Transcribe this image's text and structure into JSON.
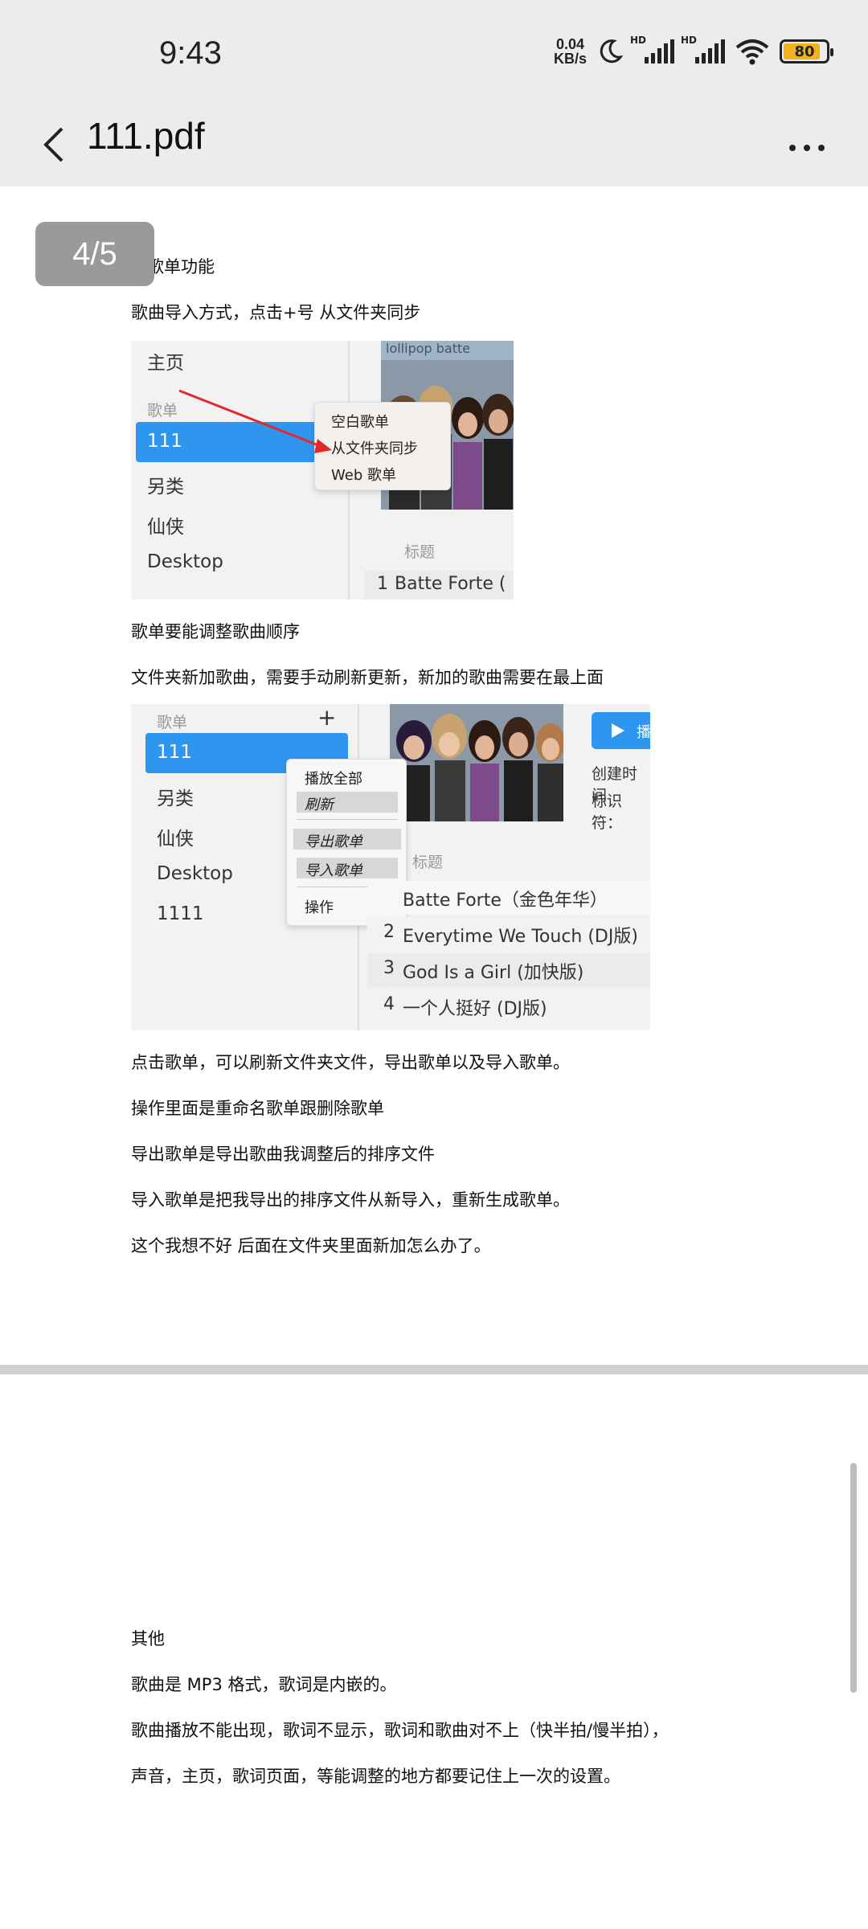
{
  "status_bar": {
    "time": "9:43",
    "net_speed_value": "0.04",
    "net_speed_unit": "KB/s",
    "sim1_label": "HD",
    "sim2_label": "HD",
    "battery": "80"
  },
  "app_bar": {
    "title": "111.pdf"
  },
  "page_indicator": "4/5",
  "page4": {
    "heading": "3.歌单功能",
    "line1": "歌曲导入方式，点击+号  从文件夹同步",
    "screenshot1": {
      "sidebar_home": "主页",
      "sidebar_section": "歌单",
      "selected_playlist": "111",
      "playlists": [
        "另类",
        "仙侠",
        "Desktop"
      ],
      "menu_items": [
        "空白歌单",
        "从文件夹同步",
        "Web 歌单"
      ],
      "photo_caption": "lollipop  batte",
      "column_title": "标题",
      "row_num": "1",
      "row_title": "Batte Forte ("
    },
    "line2": "歌单要能调整歌曲顺序",
    "line3": "文件夹新加歌曲，需要手动刷新更新，新加的歌曲需要在最上面",
    "screenshot2": {
      "sidebar_section": "歌单",
      "add_symbol": "+",
      "selected_playlist": "111",
      "playlists": [
        "另类",
        "仙侠",
        "Desktop",
        "1111"
      ],
      "menu_items": [
        "播放全部",
        "刷新",
        "导出歌单",
        "导入歌单",
        "操作"
      ],
      "menu_arrow": ">",
      "play_button": "播",
      "meta_created": "创建时间",
      "meta_id": "标识符：",
      "column_title": "标题",
      "tracks": [
        {
          "num": "",
          "title": "Batte Forte（金色年华）"
        },
        {
          "num": "2",
          "title": "Everytime We Touch (DJ版)"
        },
        {
          "num": "3",
          "title": "God Is a Girl (加快版)"
        },
        {
          "num": "4",
          "title": "一个人挺好 (DJ版)"
        }
      ]
    },
    "line4": "点击歌单，可以刷新文件夹文件，导出歌单以及导入歌单。",
    "line5": "操作里面是重命名歌单跟删除歌单",
    "line6": "导出歌单是导出歌曲我调整后的排序文件",
    "line7": "导入歌单是把我导出的排序文件从新导入，重新生成歌单。",
    "line8": "这个我想不好  后面在文件夹里面新加怎么办了。"
  },
  "page5": {
    "heading": "其他",
    "line1": "歌曲是 MP3 格式，歌词是内嵌的。",
    "line2": "歌曲播放不能出现，歌词不显示，歌词和歌曲对不上（快半拍/慢半拍），",
    "line3": "声音，主页，歌词页面，等能调整的地方都要记住上一次的设置。"
  },
  "colors": {
    "bar_bg": "#ececec",
    "accent_blue": "#2f96f0",
    "badge_bg": "#9a9a9a",
    "battery_fill": "#f2b21b"
  }
}
